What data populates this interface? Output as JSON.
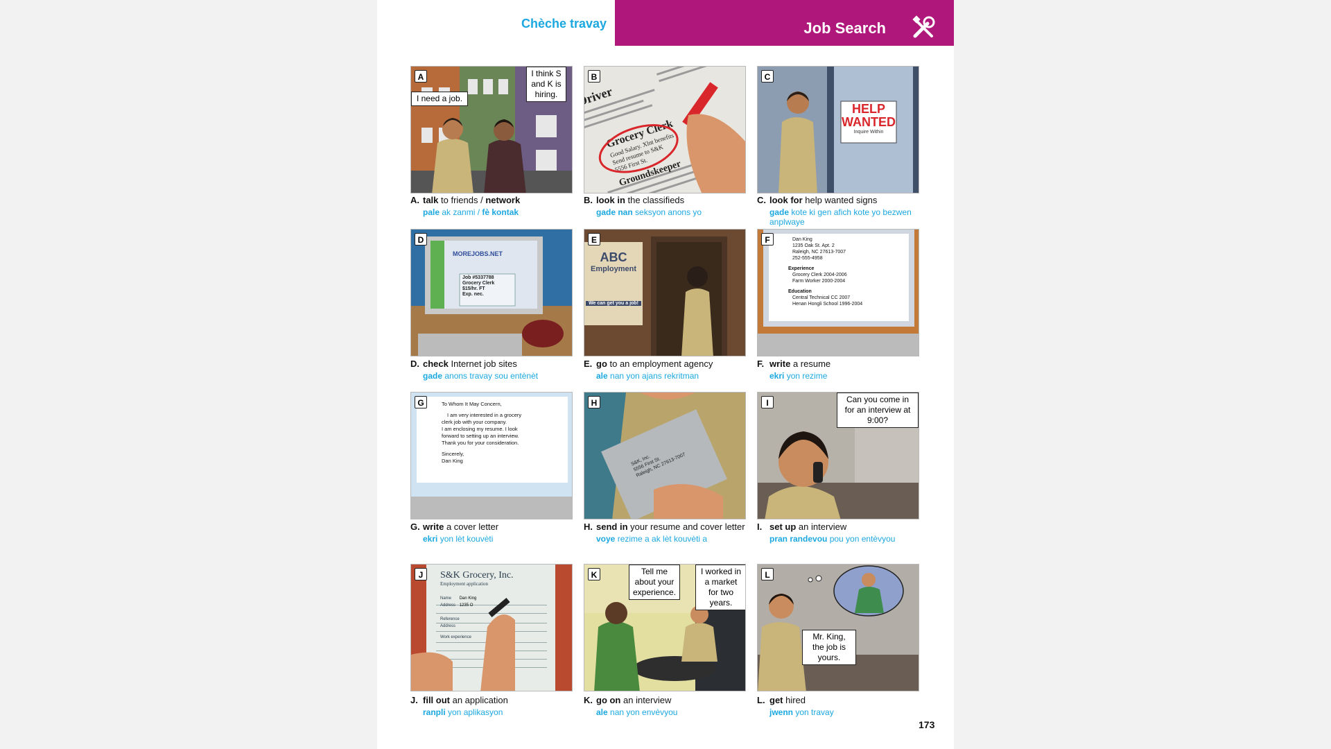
{
  "header": {
    "title_ht": "Chèche travay",
    "title_en": "Job Search",
    "icon": "tools-icon"
  },
  "page_number": "173",
  "colors": {
    "accent": "#b0177a",
    "creole": "#1ba8e0"
  },
  "items": [
    {
      "letter": "A",
      "verb": "talk",
      "rest": " to friends / ",
      "verb2": "network",
      "ht_bold": "pale",
      "ht_rest": " ak zanmi / ",
      "ht_bold2": "fè kontak",
      "ht_rest2": ""
    },
    {
      "letter": "B",
      "verb": "look in",
      "rest": " the classifieds",
      "ht_bold": "gade nan",
      "ht_rest": " seksyon anons yo"
    },
    {
      "letter": "C",
      "verb": "look for",
      "rest": " help wanted signs",
      "ht_bold": "gade",
      "ht_rest": " kote ki gen afich kote yo bezwen anplwaye"
    },
    {
      "letter": "D",
      "verb": "check",
      "rest": " Internet job sites",
      "ht_bold": "gade",
      "ht_rest": " anons travay sou entènèt"
    },
    {
      "letter": "E",
      "verb": "go",
      "rest": " to an employment agency",
      "ht_bold": "ale",
      "ht_rest": " nan yon ajans rekritman"
    },
    {
      "letter": "F",
      "verb": "write",
      "rest": " a resume",
      "ht_bold": "ekri",
      "ht_rest": " yon rezime"
    },
    {
      "letter": "G",
      "verb": "write",
      "rest": " a cover letter",
      "ht_bold": "ekri",
      "ht_rest": " yon lèt kouvèti"
    },
    {
      "letter": "H",
      "verb": "send in",
      "rest": " your resume and cover letter",
      "ht_bold": "voye",
      "ht_rest": " rezime a ak lèt kouvèti a"
    },
    {
      "letter": "I",
      "verb": "set up",
      "rest": " an interview",
      "ht_bold": "pran randevou",
      "ht_rest": " pou yon entèvyou"
    },
    {
      "letter": "J",
      "verb": "fill out",
      "rest": " an application",
      "ht_bold": "ranpli",
      "ht_rest": " yon aplikasyon"
    },
    {
      "letter": "K",
      "verb": "go on",
      "rest": " an interview",
      "ht_bold": "ale",
      "ht_rest": " nan yon envèvyou"
    },
    {
      "letter": "L",
      "verb": "get",
      "rest": " hired",
      "ht_bold": "jwenn",
      "ht_rest": " yon travay"
    }
  ],
  "bubbles": {
    "a1": "I need a job.",
    "a2": "I think S and K is hiring.",
    "i1": "Can you come in for an interview at 9:00?",
    "k1": "Tell me about your experience.",
    "k2": "I worked in a market for two years.",
    "l1": "Mr. King, the job is yours."
  },
  "scene_text": {
    "b_header": "Driver",
    "b_ad": "Grocery Clerk",
    "b_ad_line1": "Good Salary. Xlnt benefits",
    "b_ad_line2": "Send resume to S&K",
    "b_ad_line3": "5556 First St.",
    "b_ad2": "Groundskeeper",
    "c_sign1": "HELP",
    "c_sign2": "WANTED",
    "c_sign3": "Inquire Within",
    "d_site": "MOREJOBS.NET",
    "d_job": "Job #5337788",
    "d_job2": "Grocery Clerk",
    "d_job3": "$15/hr. FT",
    "d_job4": "Exp. nec.",
    "e_abc": "ABC",
    "e_emp": "Employment",
    "e_slogan": "We can get you a job!",
    "f_name": "Dan King",
    "f_addr1": "1235 Oak St. Apt. 2",
    "f_addr2": "Raleigh, NC 27613-7007",
    "f_phone": "252-555-4958",
    "f_exp": "Experience",
    "f_exp1": "Grocery Clerk  2004-2006",
    "f_exp2": "Farm Worker  2000-2004",
    "f_edu": "Education",
    "f_edu1": "Central Technical CC  2007",
    "f_edu2": "Henan Hongli School  1996-2004",
    "g_l1": "To Whom It May Concern,",
    "g_l2": "I am very interested in a grocery",
    "g_l3": "clerk job with your company.",
    "g_l4": "I am enclosing my resume. I look",
    "g_l5": "forward to setting up an interview.",
    "g_l6": "Thank you for your consideration.",
    "g_l7": "Sincerely,",
    "g_l8": "Dan King",
    "h_env1": "S&K, Inc.",
    "h_env2": "5556 First St.",
    "h_env3": "Raleigh, NC 27613-7007",
    "j_co": "S&K Grocery, Inc.",
    "j_sub": "Employment application",
    "j_name": "Name",
    "j_addr": "Address",
    "j_nameval": "Dan King",
    "j_addrval": "1235 O",
    "j_ref": "Reference",
    "j_addr2": "Address",
    "j_work": "Work experience"
  }
}
